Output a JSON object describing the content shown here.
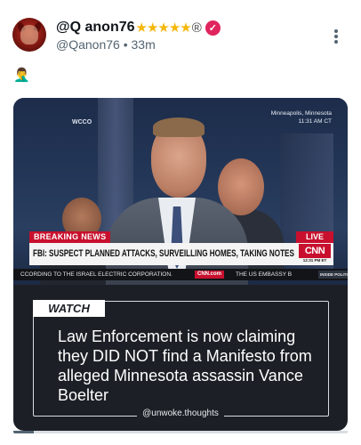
{
  "post": {
    "author_name": "@Q anon76",
    "stars": "★★★★★",
    "reg_mark": "®",
    "verified_glyph": "✓",
    "handle": "@Qanon76",
    "separator": "•",
    "time_ago": "33m",
    "body_emoji": "🤦‍♂️",
    "more_icon": "more-vertical-icon"
  },
  "media": {
    "station": "WCCO",
    "location": "Minneapolis, Minnesota",
    "local_time": "11:31 AM CT",
    "breaking_label": "BREAKING NEWS",
    "live_label": "LIVE",
    "headline": "FBI: SUSPECT PLANNED ATTACKS, SURVEILLING HOMES, TAKING NOTES",
    "network_logo": "CNN",
    "network_time": "12:31 PM ET",
    "ticker_left": "CCORDING TO THE ISRAEL ELECTRIC CORPORATION.",
    "ticker_site": "CNN.com",
    "ticker_right": "THE US EMBASSY B",
    "ticker_badge": "INSIDE POLITICS",
    "watch_label": "WATCH",
    "watch_text": "Law Enforcement is now claiming they DID NOT find a Manifesto from alleged Minnesota assassin Vance Boelter",
    "watch_credit": "@unwoke.thoughts",
    "progress": 0.06
  },
  "colors": {
    "accent_red": "#c8102e",
    "verified_pink": "#e0245e",
    "star_gold": "#f5b70a"
  }
}
